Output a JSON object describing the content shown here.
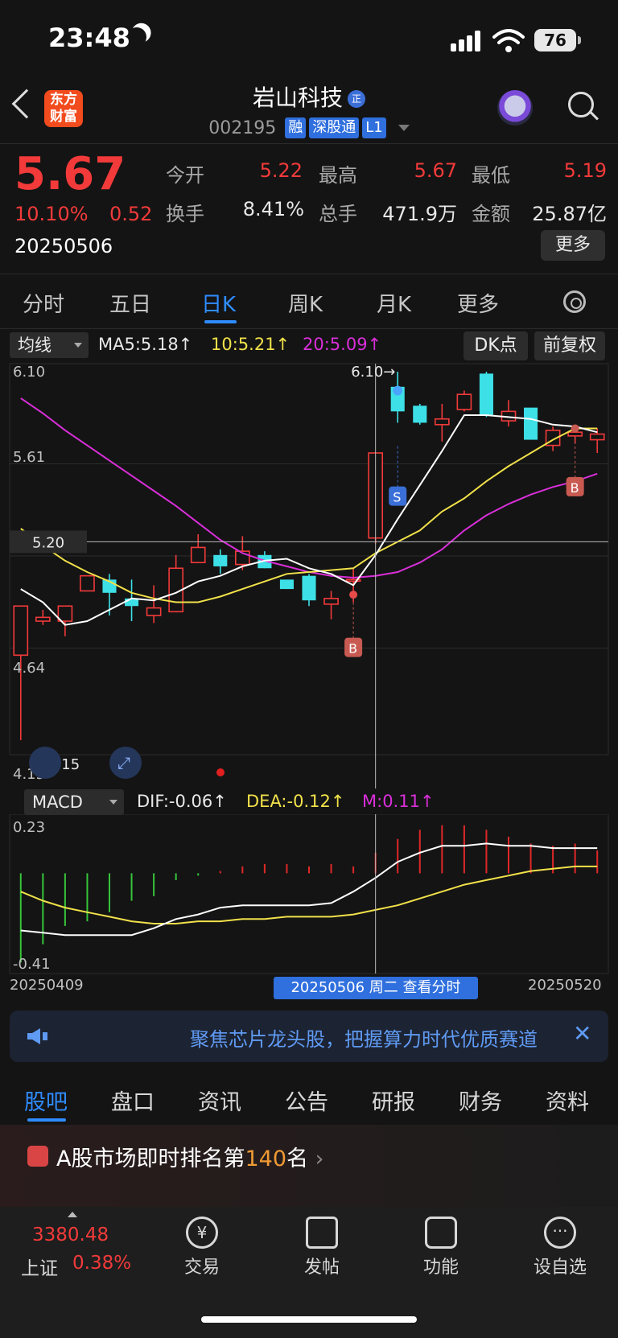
{
  "status_bar": {
    "time": "23:48",
    "battery": "76"
  },
  "header": {
    "logo_line1": "东方",
    "logo_line2": "财富",
    "stock_name": "岩山科技",
    "name_badge": "正",
    "stock_code": "002195",
    "tags": [
      "融",
      "深股通",
      "L1"
    ]
  },
  "quote": {
    "price": "5.67",
    "change_pct": "10.10%",
    "change_amt": "0.52",
    "date": "20250506",
    "fields": [
      {
        "label": "今开",
        "value": "5.22",
        "color": "red"
      },
      {
        "label": "最高",
        "value": "5.67",
        "color": "red"
      },
      {
        "label": "最低",
        "value": "5.19",
        "color": "red"
      },
      {
        "label": "换手",
        "value": "8.41%",
        "color": "white"
      },
      {
        "label": "总手",
        "value": "471.9万",
        "color": "white"
      },
      {
        "label": "金额",
        "value": "25.87亿",
        "color": "white"
      }
    ],
    "more_label": "更多"
  },
  "period_tabs": [
    "分时",
    "五日",
    "日K",
    "周K",
    "月K",
    "更多"
  ],
  "active_period": "日K",
  "ma_bar": {
    "selector": "均线",
    "ma5": "MA5:5.18↑",
    "ma10": "10:5.21↑",
    "ma20": "20:5.09↑",
    "dk_label": "DK点",
    "fq_label": "前复权"
  },
  "macd_bar": {
    "selector": "MACD",
    "dif": "DIF:-0.06↑",
    "dea": "DEA:-0.12↑",
    "m": "M:0.11↑"
  },
  "chart_labels": {
    "price_top": "6.10",
    "price_mid": "5.61",
    "price_cursor": "5.20",
    "price_low": "4.64",
    "price_bottom": "4.15",
    "max_marker": "6.10",
    "min_marker": "4.15",
    "macd_top": "0.23",
    "macd_bottom": "-0.41",
    "date_start": "20250409",
    "date_end": "20250520",
    "cursor_date": "20250506 周二 查看分时",
    "signal_b": "B",
    "signal_s": "S"
  },
  "colors": {
    "up": "#f23a3a",
    "down": "#3de0e6",
    "ma5": "#ffffff",
    "ma10": "#f1e14a",
    "ma20": "#d92fd9",
    "accent": "#2f8cff"
  },
  "chart_data": {
    "type": "candlestick",
    "ylim": [
      4.15,
      6.1
    ],
    "candles": [
      {
        "o": 4.6,
        "h": 4.8,
        "l": 4.15,
        "c": 4.86
      },
      {
        "o": 4.78,
        "h": 4.84,
        "l": 4.76,
        "c": 4.8
      },
      {
        "o": 4.78,
        "h": 4.86,
        "l": 4.7,
        "c": 4.86
      },
      {
        "o": 4.94,
        "h": 5.02,
        "l": 4.94,
        "c": 5.02
      },
      {
        "o": 5.0,
        "h": 5.03,
        "l": 4.81,
        "c": 4.93
      },
      {
        "o": 4.9,
        "h": 5.0,
        "l": 4.78,
        "c": 4.86
      },
      {
        "o": 4.81,
        "h": 4.97,
        "l": 4.77,
        "c": 4.85
      },
      {
        "o": 4.83,
        "h": 5.13,
        "l": 4.83,
        "c": 5.06
      },
      {
        "o": 5.09,
        "h": 5.24,
        "l": 5.09,
        "c": 5.17
      },
      {
        "o": 5.13,
        "h": 5.16,
        "l": 5.03,
        "c": 5.07
      },
      {
        "o": 5.08,
        "h": 5.23,
        "l": 5.05,
        "c": 5.15
      },
      {
        "o": 5.13,
        "h": 5.15,
        "l": 5.06,
        "c": 5.06
      },
      {
        "o": 5.0,
        "h": 4.99,
        "l": 4.95,
        "c": 4.95
      },
      {
        "o": 5.02,
        "h": 5.03,
        "l": 4.86,
        "c": 4.89
      },
      {
        "o": 4.87,
        "h": 4.94,
        "l": 4.79,
        "c": 4.9
      },
      {
        "o": 5.0,
        "h": 5.06,
        "l": 4.88,
        "c": 5.0
      },
      {
        "o": 5.22,
        "h": 5.67,
        "l": 5.19,
        "c": 5.67
      },
      {
        "o": 6.02,
        "h": 6.1,
        "l": 5.83,
        "c": 5.89
      },
      {
        "o": 5.92,
        "h": 5.93,
        "l": 5.82,
        "c": 5.83
      },
      {
        "o": 5.82,
        "h": 5.93,
        "l": 5.73,
        "c": 5.85
      },
      {
        "o": 5.9,
        "h": 6.0,
        "l": 5.89,
        "c": 5.98
      },
      {
        "o": 6.09,
        "h": 6.1,
        "l": 5.86,
        "c": 5.87
      },
      {
        "o": 5.84,
        "h": 5.95,
        "l": 5.81,
        "c": 5.89
      },
      {
        "o": 5.91,
        "h": 5.88,
        "l": 5.76,
        "c": 5.74
      },
      {
        "o": 5.71,
        "h": 5.81,
        "l": 5.68,
        "c": 5.79
      },
      {
        "o": 5.76,
        "h": 5.82,
        "l": 5.72,
        "c": 5.78
      },
      {
        "o": 5.74,
        "h": 5.8,
        "l": 5.67,
        "c": 5.77
      }
    ],
    "ma5": [
      4.95,
      4.88,
      4.76,
      4.78,
      4.84,
      4.9,
      4.89,
      4.93,
      4.99,
      5.02,
      5.07,
      5.1,
      5.11,
      5.06,
      5.03,
      4.97,
      5.13,
      5.32,
      5.5,
      5.68,
      5.87,
      5.87,
      5.86,
      5.85,
      5.82,
      5.81,
      5.78
    ],
    "ma10": [
      5.27,
      5.18,
      5.1,
      5.04,
      4.99,
      4.93,
      4.9,
      4.88,
      4.88,
      4.91,
      4.95,
      4.99,
      5.03,
      5.04,
      5.05,
      5.06,
      5.14,
      5.2,
      5.26,
      5.36,
      5.43,
      5.52,
      5.6,
      5.67,
      5.74,
      5.8,
      5.8
    ],
    "ma20": [
      5.96,
      5.88,
      5.79,
      5.71,
      5.63,
      5.55,
      5.47,
      5.39,
      5.3,
      5.21,
      5.14,
      5.1,
      5.07,
      5.04,
      5.02,
      5.01,
      5.02,
      5.04,
      5.09,
      5.16,
      5.26,
      5.34,
      5.4,
      5.45,
      5.49,
      5.52,
      5.56
    ],
    "macd": {
      "ylim": [
        -0.41,
        0.23
      ],
      "hist": [
        -0.39,
        -0.31,
        -0.23,
        -0.21,
        -0.17,
        -0.12,
        -0.1,
        -0.03,
        -0.01,
        0.01,
        0.03,
        0.04,
        0.04,
        0.03,
        0.04,
        0.03,
        0.09,
        0.15,
        0.19,
        0.21,
        0.21,
        0.19,
        0.16,
        0.13,
        0.12,
        0.13,
        0.1
      ],
      "dif": [
        -0.25,
        -0.26,
        -0.27,
        -0.27,
        -0.27,
        -0.27,
        -0.24,
        -0.2,
        -0.18,
        -0.15,
        -0.14,
        -0.14,
        -0.14,
        -0.14,
        -0.13,
        -0.08,
        -0.02,
        0.05,
        0.09,
        0.12,
        0.12,
        0.13,
        0.12,
        0.12,
        0.11,
        0.11,
        0.11
      ],
      "dea": [
        -0.08,
        -0.12,
        -0.15,
        -0.17,
        -0.19,
        -0.21,
        -0.22,
        -0.22,
        -0.21,
        -0.21,
        -0.2,
        -0.2,
        -0.19,
        -0.19,
        -0.19,
        -0.18,
        -0.16,
        -0.14,
        -0.11,
        -0.08,
        -0.05,
        -0.03,
        -0.01,
        0.01,
        0.02,
        0.03,
        0.03
      ]
    }
  },
  "ad_banner": {
    "text": "聚焦芯片龙头股，把握算力时代优质赛道"
  },
  "bottom_tabs": [
    "股吧",
    "盘口",
    "资讯",
    "公告",
    "研报",
    "财务",
    "资料"
  ],
  "rank": {
    "prefix": "A股市场即时排名第",
    "num": "140",
    "suffix": "名"
  },
  "bottom_nav": {
    "index_value": "3380.48",
    "index_name": "上证",
    "index_pct": "0.38%",
    "items": [
      "交易",
      "发帖",
      "功能",
      "设自选"
    ]
  }
}
